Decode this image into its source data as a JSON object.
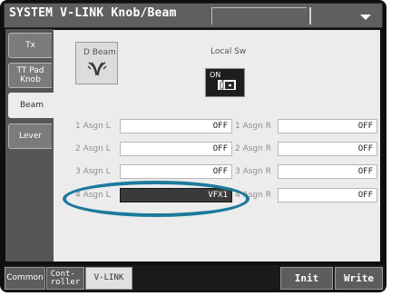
{
  "title": "SYSTEM V-LINK Knob/Beam",
  "side_tabs": [
    {
      "label": "Tx"
    },
    {
      "label": "TT Pad Knob"
    },
    {
      "label": "Beam"
    },
    {
      "label": "Lever"
    }
  ],
  "dbeam": {
    "label": "D Beam",
    "icon": "d-beam-icon"
  },
  "local_sw": {
    "label": "Local Sw",
    "state": "ON"
  },
  "rows": [
    {
      "left_label": "1 Asgn L",
      "left_value": "OFF",
      "right_label": "1 Asgn R",
      "right_value": "OFF"
    },
    {
      "left_label": "2 Asgn L",
      "left_value": "OFF",
      "right_label": "2 Asgn R",
      "right_value": "OFF"
    },
    {
      "left_label": "3 Asgn L",
      "left_value": "OFF",
      "right_label": "3 Asgn R",
      "right_value": "OFF"
    },
    {
      "left_label": "4 Asgn L",
      "left_value": "VFX1",
      "right_label": "4 Asgn R",
      "right_value": "OFF"
    }
  ],
  "bottom_tabs": [
    {
      "label": "Common"
    },
    {
      "label": "Cont-\nroller"
    },
    {
      "label": "V-LINK"
    }
  ],
  "buttons": {
    "init": "Init",
    "write": "Write"
  },
  "colors": {
    "highlight_ring": "#1c7a9c",
    "panel": "#ececec",
    "selected_field": "#3a3a3a"
  }
}
